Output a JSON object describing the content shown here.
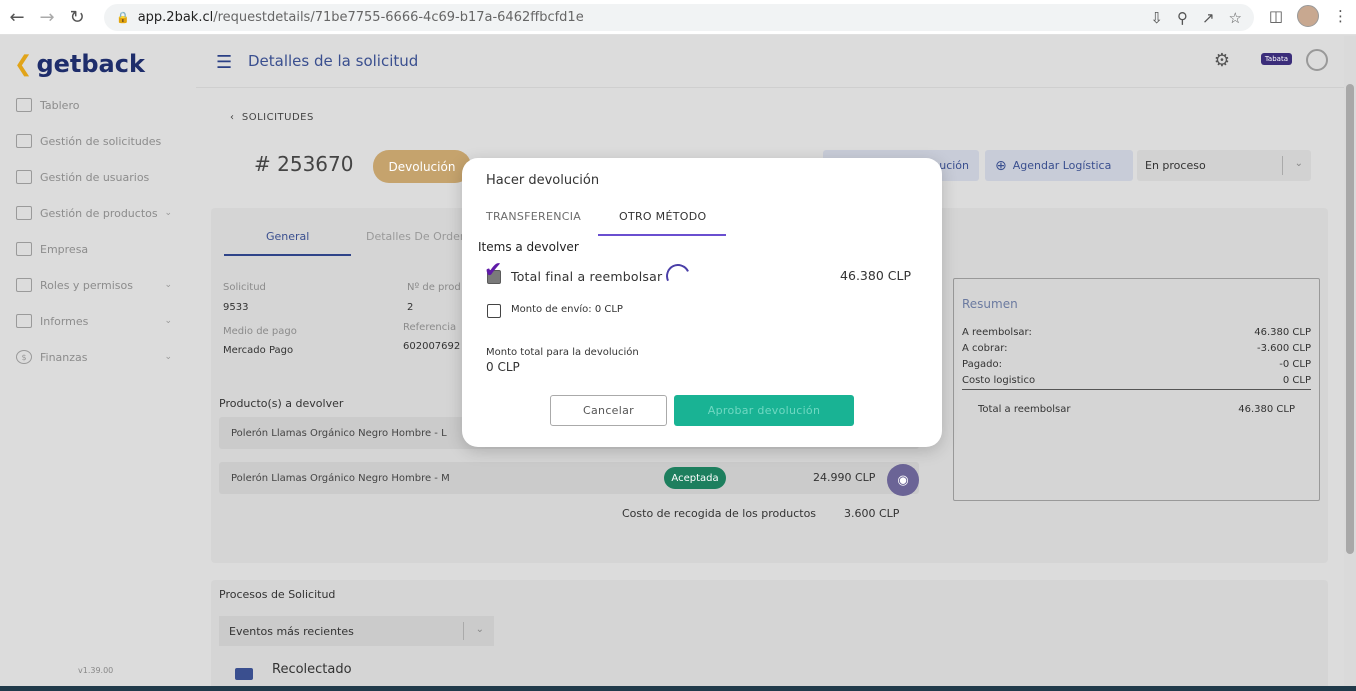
{
  "browser": {
    "url_host": "app.2bak.cl",
    "url_path": "/requestdetails/71be7755-6666-4c69-b17a-6462ffbcfd1e"
  },
  "app": {
    "logo_text": "getback",
    "page_title": "Detalles de la solicitud",
    "user_badge": "Tabata",
    "version": "v1.39.00"
  },
  "sidebar": {
    "items": [
      {
        "label": "Tablero",
        "icon": "dashboard-icon"
      },
      {
        "label": "Gestión de solicitudes",
        "icon": "requests-icon"
      },
      {
        "label": "Gestión de usuarios",
        "icon": "users-icon"
      },
      {
        "label": "Gestión de productos",
        "icon": "box-icon"
      },
      {
        "label": "Empresa",
        "icon": "building-icon"
      },
      {
        "label": "Roles y permisos",
        "icon": "roles-icon"
      },
      {
        "label": "Informes",
        "icon": "report-icon"
      },
      {
        "label": "Finanzas",
        "icon": "dollar-icon"
      }
    ]
  },
  "request": {
    "breadcrumb": "SOLICITUDES",
    "number": "# 253670",
    "type": "Devolución",
    "btn_devolucion": "ución",
    "btn_logistica": "Agendar Logística",
    "status": "En proceso",
    "tab_general": "General",
    "tab_detalles": "Detalles De Orden",
    "fields": {
      "solicitud_label": "Solicitud",
      "solicitud_value": "9533",
      "nro_label": "Nº de prod",
      "nro_value": "2",
      "medio_label": "Medio de pago",
      "medio_value": "Mercado Pago",
      "referencia_label": "Referencia",
      "referencia_value": "602007692"
    },
    "products_title": "Producto(s) a devolver",
    "products": [
      {
        "name": "Polerón Llamas Orgánico Negro Hombre - L"
      },
      {
        "name": "Polerón Llamas Orgánico Negro Hombre - M",
        "status": "Aceptada",
        "price": "24.990 CLP"
      }
    ],
    "pickup_label": "Costo de recogida de los productos",
    "pickup_value": "3.600 CLP"
  },
  "resumen": {
    "title": "Resumen",
    "rows": [
      {
        "label": "A reembolsar:",
        "value": "46.380 CLP"
      },
      {
        "label": "A cobrar:",
        "value": "-3.600 CLP"
      },
      {
        "label": "Pagado:",
        "value": "-0 CLP"
      },
      {
        "label": "Costo logistico",
        "value": "0 CLP"
      }
    ],
    "total_label": "Total a reembolsar",
    "total_value": "46.380 CLP"
  },
  "processes": {
    "title": "Procesos de Solicitud",
    "events_select": "Eventos más recientes",
    "event_title": "Recolectado"
  },
  "modal": {
    "title": "Hacer devolución",
    "tab_transfer": "TRANSFERENCIA",
    "tab_other": "OTRO MÉTODO",
    "items_label": "Items a devolver",
    "row_total_label": "Total final a reembolsar",
    "row_total_amount": "46.380 CLP",
    "row_ship_label": "Monto de envío: 0 CLP",
    "total_label": "Monto total para la devolución",
    "total_value": "0 CLP",
    "cancel": "Cancelar",
    "approve": "Aprobar devolución"
  },
  "colors": {
    "accent_purple": "#6a4fd0",
    "approve_green": "#19b394",
    "brand_navy": "#1e2d6b",
    "brand_gold": "#e1a419"
  }
}
